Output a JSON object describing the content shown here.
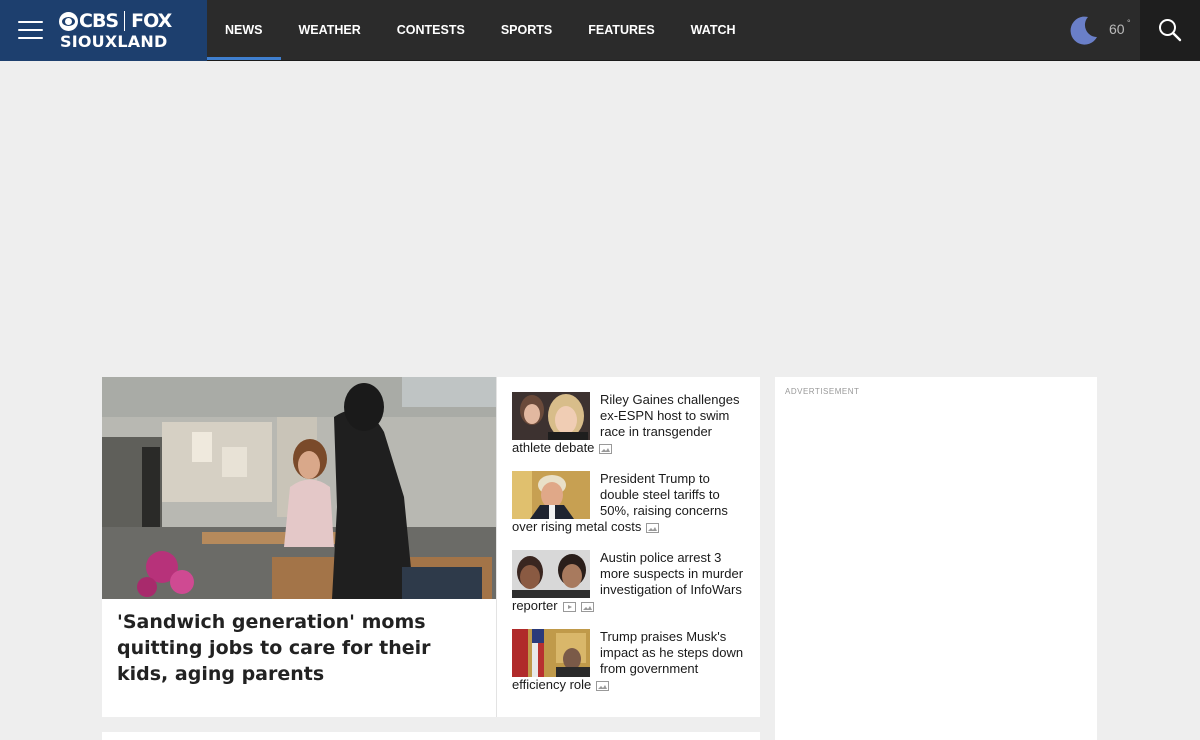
{
  "brand": {
    "logo_cbs": "CBS",
    "logo_fox": "FOX",
    "logo_sub": "SIOUXLAND"
  },
  "nav": {
    "items": [
      {
        "label": "NEWS",
        "active": true
      },
      {
        "label": "WEATHER"
      },
      {
        "label": "CONTESTS"
      },
      {
        "label": "SPORTS"
      },
      {
        "label": "FEATURES"
      },
      {
        "label": "WATCH"
      }
    ]
  },
  "weather": {
    "temp": "60",
    "deg": "°",
    "icon": "moon-icon"
  },
  "search": {
    "icon": "search-icon"
  },
  "featured": {
    "title": "'Sandwich generation' moms quitting jobs to care for their kids, aging parents"
  },
  "side_stories": [
    {
      "title": "Riley Gaines challenges ex-ESPN host to swim race in transgender athlete debate",
      "icons": [
        "gallery-icon"
      ]
    },
    {
      "title": "President Trump to double steel tariffs to 50%, raising concerns over rising metal costs",
      "icons": [
        "gallery-icon"
      ]
    },
    {
      "title": "Austin police arrest 3 more suspects in murder investigation of InfoWars reporter",
      "icons": [
        "video-icon",
        "gallery-icon"
      ]
    },
    {
      "title": "Trump praises Musk's impact as he steps down from government efficiency role",
      "icons": [
        "gallery-icon"
      ]
    }
  ],
  "ad": {
    "label": "ADVERTISEMENT"
  },
  "colors": {
    "header_bg": "#2b2b2b",
    "brand_bg": "#1d3f6e",
    "nav_active": "#3f7fcf",
    "page_bg": "#eeeeee"
  }
}
